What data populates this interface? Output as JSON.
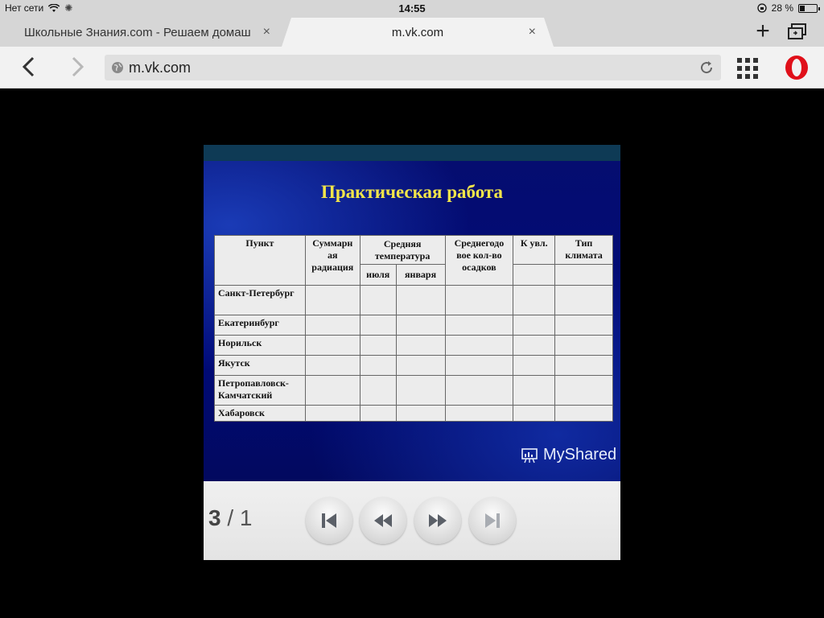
{
  "status_bar": {
    "network": "Нет сети",
    "time": "14:55",
    "battery": "28 %",
    "battery_level": 0.28
  },
  "tabs": [
    {
      "label": "Школьные Знания.com - Решаем домаш",
      "close": "×"
    },
    {
      "label": "m.vk.com",
      "close": "×"
    }
  ],
  "toolbar": {
    "new_tab": "+",
    "url": "m.vk.com"
  },
  "slide": {
    "title": "Практическая работа",
    "table": {
      "headers": {
        "point": "Пункт",
        "radiation": "Суммарн ая радиация",
        "avg_temp": "Средняя температура",
        "july": "июля",
        "january": "января",
        "precip": "Среднегодо вое кол-во осадков",
        "k_uvl": "К увл.",
        "climate": "Тип климата"
      },
      "rows": [
        "Санкт-Петербург",
        "Екатеринбург",
        "Норильск",
        "Якутск",
        "Петропавловск-Камчатский",
        "Хабаровск"
      ]
    },
    "logo": "MyShared"
  },
  "player": {
    "current": "3",
    "separator": "/",
    "total": "1"
  }
}
